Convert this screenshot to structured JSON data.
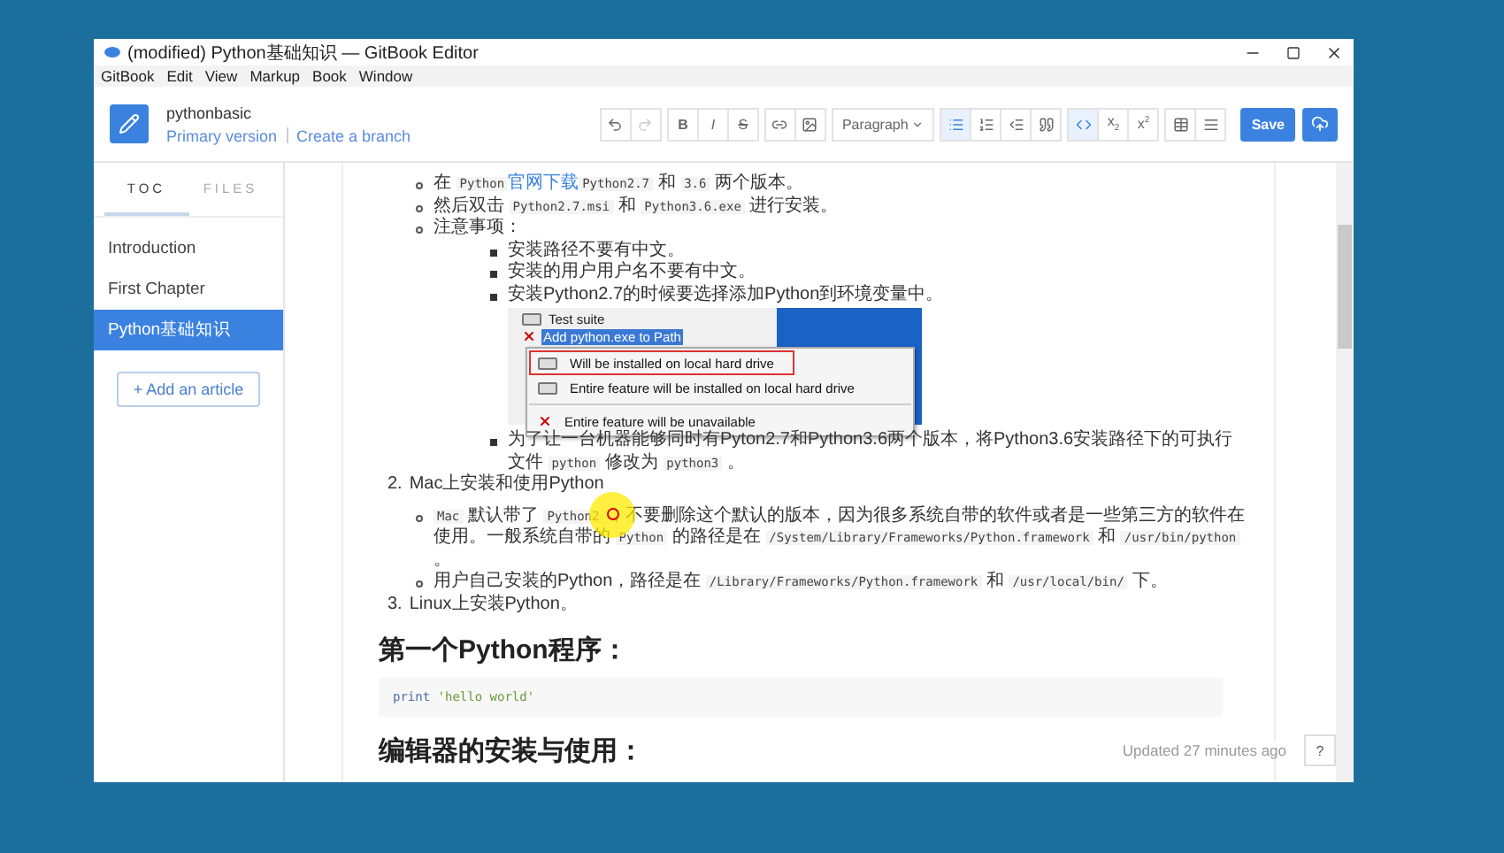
{
  "window": {
    "title": "(modified) Python基础知识 — GitBook Editor"
  },
  "menu": [
    "GitBook",
    "Edit",
    "View",
    "Markup",
    "Book",
    "Window"
  ],
  "header": {
    "book": "pythonbasic",
    "version": "Primary version",
    "branch_link": "Create a branch"
  },
  "toolbar": {
    "groups": [
      [
        {
          "kind": "undo",
          "active": false,
          "disabled": false
        },
        {
          "kind": "redo",
          "active": false,
          "disabled": true
        }
      ],
      [
        {
          "kind": "bold",
          "label": "B",
          "active": false,
          "disabled": false
        },
        {
          "kind": "italic",
          "label": "I",
          "active": false,
          "disabled": false
        },
        {
          "kind": "strike",
          "label": "S",
          "active": false,
          "disabled": false
        }
      ],
      [
        {
          "kind": "link",
          "active": false,
          "disabled": false
        },
        {
          "kind": "image",
          "active": false,
          "disabled": false
        }
      ],
      [
        {
          "kind": "dropdown",
          "label": "Paragraph",
          "active": false,
          "disabled": false
        }
      ],
      [
        {
          "kind": "bullet-list",
          "active": true,
          "disabled": false
        },
        {
          "kind": "numbered-list",
          "active": false,
          "disabled": false
        },
        {
          "kind": "outdent",
          "active": false,
          "disabled": false
        },
        {
          "kind": "quote",
          "active": false,
          "disabled": false
        }
      ],
      [
        {
          "kind": "code",
          "active": true,
          "disabled": false
        },
        {
          "kind": "subscript",
          "label": "x$_{2}$",
          "active": false,
          "disabled": false
        },
        {
          "kind": "superscript",
          "label": "x$^{2}$",
          "active": false,
          "disabled": false
        }
      ],
      [
        {
          "kind": "table",
          "active": false,
          "disabled": false
        },
        {
          "kind": "rule",
          "active": false,
          "disabled": false
        }
      ]
    ],
    "save": "Save"
  },
  "sidebar": {
    "tabs": [
      {
        "label": "TOC",
        "selected": true
      },
      {
        "label": "FILES",
        "selected": false
      }
    ],
    "items": [
      {
        "label": "Introduction",
        "selected": false
      },
      {
        "label": "First Chapter",
        "selected": false
      },
      {
        "label": "Python基础知识",
        "selected": true
      }
    ],
    "add_button": "+ Add an article"
  },
  "content": {
    "bullets": [
      {
        "segments": [
          {
            "kind": "text",
            "text": "在 "
          },
          {
            "kind": "code",
            "text": "Python"
          },
          {
            "kind": "link",
            "text": "官网下载"
          },
          {
            "kind": "code",
            "text": "Python2.7"
          },
          {
            "kind": "text",
            "text": " 和 "
          },
          {
            "kind": "code",
            "text": "3.6"
          },
          {
            "kind": "text",
            "text": " 两个版本。"
          }
        ]
      },
      {
        "segments": [
          {
            "kind": "text",
            "text": "然后双击 "
          },
          {
            "kind": "code",
            "text": "Python2.7.msi"
          },
          {
            "kind": "text",
            "text": " 和 "
          },
          {
            "kind": "code",
            "text": "Python3.6.exe"
          },
          {
            "kind": "text",
            "text": " 进行安装。"
          }
        ]
      },
      {
        "segments": [
          {
            "kind": "text",
            "text": "注意事项："
          }
        ],
        "children": [
          {
            "segments": [
              {
                "kind": "text",
                "text": "安装路径不要有中文。"
              }
            ]
          },
          {
            "segments": [
              {
                "kind": "text",
                "text": "安装的用户用户名不要有中文。"
              }
            ]
          },
          {
            "segments": [
              {
                "kind": "text",
                "text": "安装Python2.7的时候要选择添加Python到环境变量中。"
              }
            ],
            "figure": {
              "rows": [
                {
                  "label": "Test suite",
                  "selected": false,
                  "excluded": false
                },
                {
                  "label": "Add python.exe to Path",
                  "selected": true,
                  "excluded": true
                }
              ],
              "menu": [
                {
                  "kind": "drive",
                  "label": "Will be installed on local hard drive",
                  "highlighted": true
                },
                {
                  "kind": "drive-all",
                  "label": "Entire feature will be installed on local hard drive",
                  "highlighted": false
                },
                {
                  "kind": "unavailable",
                  "label": "Entire feature will be unavailable",
                  "highlighted": false
                }
              ]
            }
          },
          {
            "segments": [
              {
                "kind": "text",
                "text": "为了让一台机器能够同时有Pyton2.7和Python3.6两个版本，将Python3.6安装路径下的可执行文件 "
              },
              {
                "kind": "code",
                "text": "python"
              },
              {
                "kind": "text",
                "text": " 修改为 "
              },
              {
                "kind": "code",
                "text": "python3"
              },
              {
                "kind": "text",
                "text": " 。"
              }
            ]
          }
        ]
      }
    ],
    "ordered": [
      {
        "number": "2.",
        "text": "Mac上安装和使用Python",
        "children": [
          {
            "segments": [
              {
                "kind": "code",
                "text": "Mac"
              },
              {
                "kind": "text",
                "text": " 默认带了 "
              },
              {
                "kind": "code",
                "text": "Python2"
              },
              {
                "kind": "text",
                "text": " ，不要删除这个默认的版本，因为很多系统自带的软件或者是一些第三方的软件在使用。一般系统自带的 "
              },
              {
                "kind": "code",
                "text": "Python"
              },
              {
                "kind": "text",
                "text": " 的路径是在 "
              },
              {
                "kind": "code",
                "text": "/System/Library/Frameworks/Python.framework"
              },
              {
                "kind": "text",
                "text": " 和 "
              },
              {
                "kind": "code",
                "text": "/usr/bin/python"
              },
              {
                "kind": "text",
                "text": " 。"
              }
            ]
          },
          {
            "segments": [
              {
                "kind": "text",
                "text": "用户自己安装的Python，路径是在 "
              },
              {
                "kind": "code",
                "text": "/Library/Frameworks/Python.framework"
              },
              {
                "kind": "text",
                "text": " 和 "
              },
              {
                "kind": "code",
                "text": "/usr/local/bin/"
              },
              {
                "kind": "text",
                "text": " 下。"
              }
            ]
          }
        ]
      },
      {
        "number": "3.",
        "text": "Linux上安装Python。"
      }
    ],
    "heading": "第一个Python程序：",
    "code_block": [
      {
        "kind": "keyword",
        "text": "print"
      },
      {
        "kind": "string",
        "text": " 'hello world'"
      }
    ],
    "heading_2": "编辑器的安装与使用："
  },
  "status_bar": {
    "updated": "Updated 27 minutes ago",
    "help": "?"
  }
}
